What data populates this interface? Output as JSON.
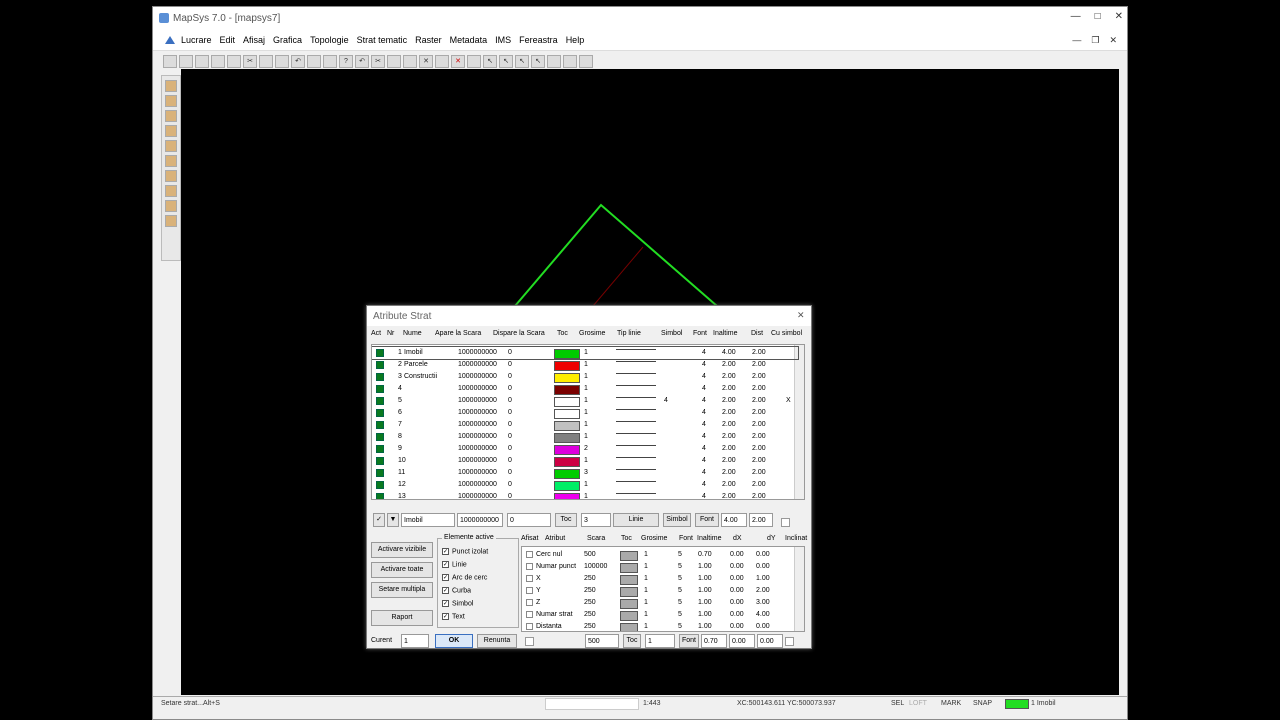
{
  "app": {
    "title": "MapSys 7.0 - [mapsys7]",
    "menu": [
      "Lucrare",
      "Edit",
      "Afisaj",
      "Grafica",
      "Topologie",
      "Strat tematic",
      "Raster",
      "Metadata",
      "IMS",
      "Fereastra",
      "Help"
    ]
  },
  "dialog": {
    "title": "Atribute Strat",
    "headers": [
      "Act",
      "Nr",
      "Nume",
      "Apare la Scara",
      "Dispare la Scara",
      "Toc",
      "Grosime",
      "Tip linie",
      "Simbol",
      "Font",
      "Inaltime",
      "Dist",
      "Cu simbol"
    ],
    "rows": [
      {
        "nr": "1",
        "nume": "Imobil",
        "apare": "1000000000",
        "dispare": "0",
        "color": "#00cc00",
        "gros": "1",
        "font": "4",
        "inalt": "4.00",
        "dist": "2.00",
        "simbol": "",
        "cusimbol": ""
      },
      {
        "nr": "2",
        "nume": "Parcele",
        "apare": "1000000000",
        "dispare": "0",
        "color": "#ee0000",
        "gros": "1",
        "font": "4",
        "inalt": "2.00",
        "dist": "2.00",
        "simbol": "",
        "cusimbol": ""
      },
      {
        "nr": "3",
        "nume": "Constructii",
        "apare": "1000000000",
        "dispare": "0",
        "color": "#ffee00",
        "gros": "1",
        "font": "4",
        "inalt": "2.00",
        "dist": "2.00",
        "simbol": "",
        "cusimbol": ""
      },
      {
        "nr": "4",
        "nume": "",
        "apare": "1000000000",
        "dispare": "0",
        "color": "#7a0000",
        "gros": "1",
        "font": "4",
        "inalt": "2.00",
        "dist": "2.00",
        "simbol": "",
        "cusimbol": ""
      },
      {
        "nr": "5",
        "nume": "",
        "apare": "1000000000",
        "dispare": "0",
        "color": "#ffffff",
        "gros": "1",
        "font": "4",
        "inalt": "2.00",
        "dist": "2.00",
        "simbol": "4",
        "cusimbol": "X"
      },
      {
        "nr": "6",
        "nume": "",
        "apare": "1000000000",
        "dispare": "0",
        "color": "#ffffff",
        "gros": "1",
        "font": "4",
        "inalt": "2.00",
        "dist": "2.00",
        "simbol": "",
        "cusimbol": ""
      },
      {
        "nr": "7",
        "nume": "",
        "apare": "1000000000",
        "dispare": "0",
        "color": "#c0c0c0",
        "gros": "1",
        "font": "4",
        "inalt": "2.00",
        "dist": "2.00",
        "simbol": "",
        "cusimbol": ""
      },
      {
        "nr": "8",
        "nume": "",
        "apare": "1000000000",
        "dispare": "0",
        "color": "#808080",
        "gros": "1",
        "font": "4",
        "inalt": "2.00",
        "dist": "2.00",
        "simbol": "",
        "cusimbol": ""
      },
      {
        "nr": "9",
        "nume": "",
        "apare": "1000000000",
        "dispare": "0",
        "color": "#dd00dd",
        "gros": "2",
        "font": "4",
        "inalt": "2.00",
        "dist": "2.00",
        "simbol": "",
        "cusimbol": ""
      },
      {
        "nr": "10",
        "nume": "",
        "apare": "1000000000",
        "dispare": "0",
        "color": "#cc0044",
        "gros": "1",
        "font": "4",
        "inalt": "2.00",
        "dist": "2.00",
        "simbol": "",
        "cusimbol": ""
      },
      {
        "nr": "11",
        "nume": "",
        "apare": "1000000000",
        "dispare": "0",
        "color": "#00cc00",
        "gros": "3",
        "font": "4",
        "inalt": "2.00",
        "dist": "2.00",
        "simbol": "",
        "cusimbol": ""
      },
      {
        "nr": "12",
        "nume": "",
        "apare": "1000000000",
        "dispare": "0",
        "color": "#00ee66",
        "gros": "1",
        "font": "4",
        "inalt": "2.00",
        "dist": "2.00",
        "simbol": "",
        "cusimbol": ""
      },
      {
        "nr": "13",
        "nume": "",
        "apare": "1000000000",
        "dispare": "0",
        "color": "#ee00ee",
        "gros": "1",
        "font": "4",
        "inalt": "2.00",
        "dist": "2.00",
        "simbol": "",
        "cusimbol": ""
      }
    ],
    "edit": {
      "nume": "Imobil",
      "apare": "1000000000",
      "dispare": "0",
      "toc_btn": "Toc",
      "gros": "3",
      "linie_btn": "Linie",
      "simbol_btn": "Simbol",
      "font_btn": "Font",
      "inalt": "4.00",
      "dist": "2.00"
    },
    "left_buttons": [
      "Activare vizibile",
      "Activare toate",
      "Setare multipla",
      "Raport"
    ],
    "group_label": "Elemente active",
    "checks": [
      "Punct izolat",
      "Linie",
      "Arc de cerc",
      "Curba",
      "Simbol",
      "Text"
    ],
    "headers2": [
      "Afisat",
      "Atribut",
      "Scara",
      "Toc",
      "Grosime",
      "Font",
      "Inaltime",
      "dX",
      "dY",
      "Inclinat"
    ],
    "rows2": [
      {
        "atr": "Cerc nul",
        "scara": "500",
        "gros": "1",
        "font": "5",
        "inalt": "0.70",
        "dx": "0.00",
        "dy": "0.00"
      },
      {
        "atr": "Numar punct",
        "scara": "100000",
        "gros": "1",
        "font": "5",
        "inalt": "1.00",
        "dx": "0.00",
        "dy": "0.00"
      },
      {
        "atr": "X",
        "scara": "250",
        "gros": "1",
        "font": "5",
        "inalt": "1.00",
        "dx": "0.00",
        "dy": "1.00"
      },
      {
        "atr": "Y",
        "scara": "250",
        "gros": "1",
        "font": "5",
        "inalt": "1.00",
        "dx": "0.00",
        "dy": "2.00"
      },
      {
        "atr": "Z",
        "scara": "250",
        "gros": "1",
        "font": "5",
        "inalt": "1.00",
        "dx": "0.00",
        "dy": "3.00"
      },
      {
        "atr": "Numar strat",
        "scara": "250",
        "gros": "1",
        "font": "5",
        "inalt": "1.00",
        "dx": "0.00",
        "dy": "4.00"
      },
      {
        "atr": "Distanta",
        "scara": "250",
        "gros": "1",
        "font": "5",
        "inalt": "1.00",
        "dx": "0.00",
        "dy": "0.00"
      }
    ],
    "bottom": {
      "curent_label": "Curent",
      "curent": "1",
      "ok": "OK",
      "renunta": "Renunta",
      "scara": "500",
      "toc_btn": "Toc",
      "gros": "1",
      "font_btn": "Font",
      "inalt": "0.70",
      "dx": "0.00",
      "dy": "0.00"
    }
  },
  "status": {
    "hint": "Setare strat...Alt+S",
    "scale": "1:443",
    "coords": "XC:500143.611 YC:500073.937",
    "sel": "SEL",
    "loft": "LOFT",
    "mark": "MARK",
    "snap": "SNAP",
    "layer": "1 Imobil"
  }
}
